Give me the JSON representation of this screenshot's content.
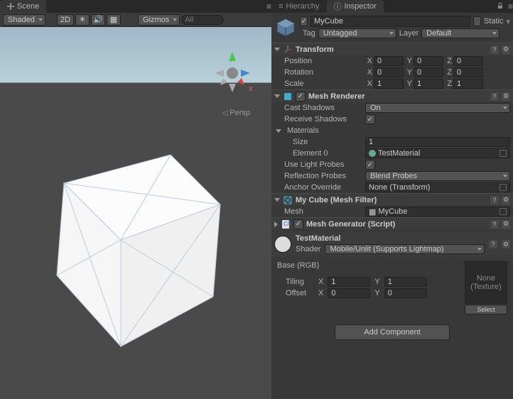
{
  "scene": {
    "tab_label": "Scene",
    "shading_mode": "Shaded",
    "btn_2d": "2D",
    "gizmos_label": "Gizmos",
    "search_placeholder": "All",
    "persp_label": "Persp"
  },
  "hierarchy": {
    "tab_label": "Hierarchy"
  },
  "inspector": {
    "tab_label": "Inspector",
    "object_name": "MyCube",
    "static_label": "Static",
    "tag_label": "Tag",
    "tag_value": "Untagged",
    "layer_label": "Layer",
    "layer_value": "Default"
  },
  "transform": {
    "title": "Transform",
    "position_label": "Position",
    "rotation_label": "Rotation",
    "scale_label": "Scale",
    "pos": {
      "x": "0",
      "y": "0",
      "z": "0"
    },
    "rot": {
      "x": "0",
      "y": "0",
      "z": "0"
    },
    "scale": {
      "x": "1",
      "y": "1",
      "z": "1"
    }
  },
  "renderer": {
    "title": "Mesh Renderer",
    "cast_shadows_label": "Cast Shadows",
    "cast_shadows_value": "On",
    "receive_shadows_label": "Receive Shadows",
    "materials_label": "Materials",
    "size_label": "Size",
    "size_value": "1",
    "element0_label": "Element 0",
    "element0_value": "TestMaterial",
    "use_light_probes_label": "Use Light Probes",
    "reflection_probes_label": "Reflection Probes",
    "reflection_probes_value": "Blend Probes",
    "anchor_override_label": "Anchor Override",
    "anchor_override_value": "None (Transform)"
  },
  "mesh_filter": {
    "title": "My Cube (Mesh Filter)",
    "mesh_label": "Mesh",
    "mesh_value": "MyCube"
  },
  "mesh_generator": {
    "title": "Mesh Generator (Script)"
  },
  "material": {
    "name": "TestMaterial",
    "shader_label": "Shader",
    "shader_value": "Mobile/Unlit (Supports Lightmap)",
    "base_label": "Base (RGB)",
    "texture_none": "None",
    "texture_type": "(Texture)",
    "select_label": "Select",
    "tiling_label": "Tiling",
    "offset_label": "Offset",
    "tiling": {
      "x": "1",
      "y": "1"
    },
    "offset": {
      "x": "0",
      "y": "0"
    }
  },
  "add_component_label": "Add Component"
}
